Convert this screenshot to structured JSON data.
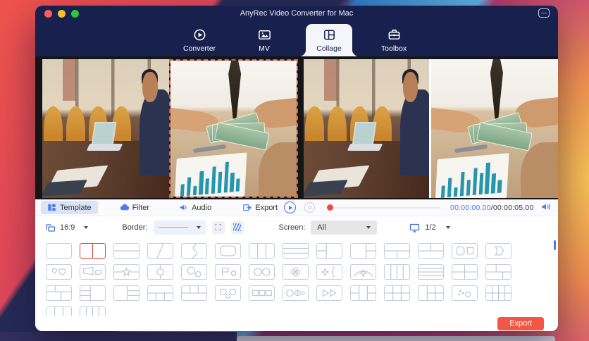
{
  "window": {
    "title": "AnyRec Video Converter for Mac"
  },
  "nav": {
    "active": "collage",
    "tabs": [
      {
        "id": "converter",
        "label": "Converter"
      },
      {
        "id": "mv",
        "label": "MV"
      },
      {
        "id": "collage",
        "label": "Collage"
      },
      {
        "id": "toolbox",
        "label": "Toolbox"
      }
    ]
  },
  "toolbar": {
    "active": "template",
    "tabs": [
      {
        "id": "template",
        "label": "Template"
      },
      {
        "id": "filter",
        "label": "Filter"
      },
      {
        "id": "audio",
        "label": "Audio"
      },
      {
        "id": "export",
        "label": "Export"
      }
    ]
  },
  "playback": {
    "current_time": "00:00:00.00",
    "divider": "/",
    "total_time": "00:00:05.00"
  },
  "options": {
    "aspect_ratio": "16:9",
    "border_label": "Border:",
    "screen_label": "Screen:",
    "screen_value": "All",
    "page_indicator": "1/2"
  },
  "footer": {
    "export_label": "Export"
  },
  "colors": {
    "accent_blue": "#4a7df0",
    "header_navy": "#18214d",
    "selection_red": "#e2574c",
    "export_red": "#f25645"
  },
  "template_grid": {
    "selected_row": 0,
    "selected_col": 1,
    "rows": [
      [
        "blank",
        "split-2v",
        "split-2h",
        "diagonal-split",
        "curve-split",
        "rounded-frame",
        "split-3v",
        "split-3h",
        "left-split-right-big",
        "left-big-right-split",
        "top-full-bottom-split",
        "top-split-bottom-full",
        "octagon-square",
        "pentagon-frame"
      ],
      [
        "hearts",
        "trapezoids",
        "star-line",
        "circle-line",
        "circles-duo",
        "flag-gear",
        "circles-pair",
        "clover",
        "burst-curve",
        "arc-star",
        "split-4v",
        "split-4h",
        "grid-2x2",
        "grid-offset"
      ],
      [
        "grid-corner",
        "left-2rows-right-big",
        "left-big-right-2rows",
        "top-full-bottom-3",
        "top-3-bottom-full",
        "circles-trio",
        "squares-trio",
        "circle-split-dot",
        "triangles-duo",
        "cols-outer-split",
        "grid-3x2",
        "left-col-grid",
        "dots-circle",
        "grid-4x2"
      ],
      [
        "split-3v",
        "split-4v"
      ]
    ]
  }
}
